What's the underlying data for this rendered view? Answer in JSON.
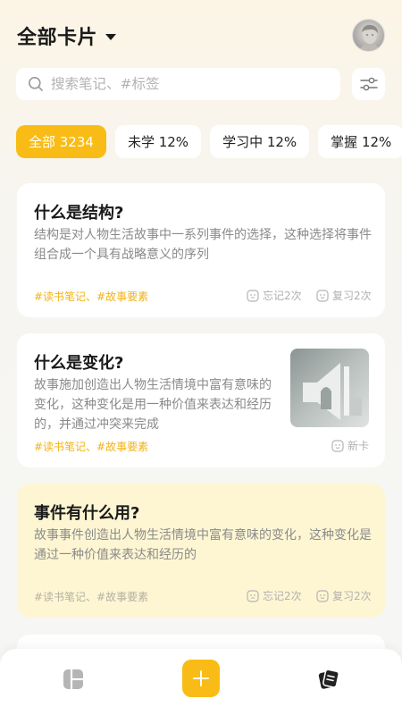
{
  "header": {
    "title": "全部卡片",
    "dropdown_icon": "caret-down-icon",
    "avatar_alt": "user-avatar"
  },
  "search": {
    "placeholder": "搜索笔记、#标签",
    "value": "",
    "icon": "search-icon"
  },
  "filter": {
    "icon": "filter-sliders-icon"
  },
  "tabs": [
    {
      "label": "全部 3234",
      "active": true
    },
    {
      "label": "未学 12%",
      "active": false
    },
    {
      "label": "学习中 12%",
      "active": false
    },
    {
      "label": "掌握 12%",
      "active": false
    }
  ],
  "cards": [
    {
      "title": "什么是结构?",
      "body_lines": [
        "结构是对人物生活故事中一系列事件的选择，这种选择将事件",
        "组合成一个具有战略意义的序列"
      ],
      "tags": "#读书笔记、#故事要素",
      "forget": "忘记2次",
      "review": "复习2次"
    },
    {
      "title": "什么是变化?",
      "body_lines": [
        "故事施加创造出人物生活情境中富有意味的",
        "变化，这种变化是用一种价值来表达和经历",
        "的，并通过冲突来完成"
      ],
      "tags": "#读书笔记、#故事要素",
      "status": "新卡",
      "has_image": true
    },
    {
      "title": "事件有什么用?",
      "body_lines": [
        "故事事件创造出人物生活情境中富有意味的变化，这种变化是",
        "通过一种价值来表达和经历的"
      ],
      "tags": "#读书笔记、#故事要素",
      "forget": "忘记2次",
      "review": "复习2次"
    }
  ],
  "colors": {
    "accent": "#f9bc16",
    "tag": "#f3b213",
    "highlight_card": "#fef6d3"
  },
  "bottom_nav": {
    "left_icon": "cards-grid-icon",
    "center_icon": "plus-icon",
    "right_icon": "card-stack-icon"
  }
}
